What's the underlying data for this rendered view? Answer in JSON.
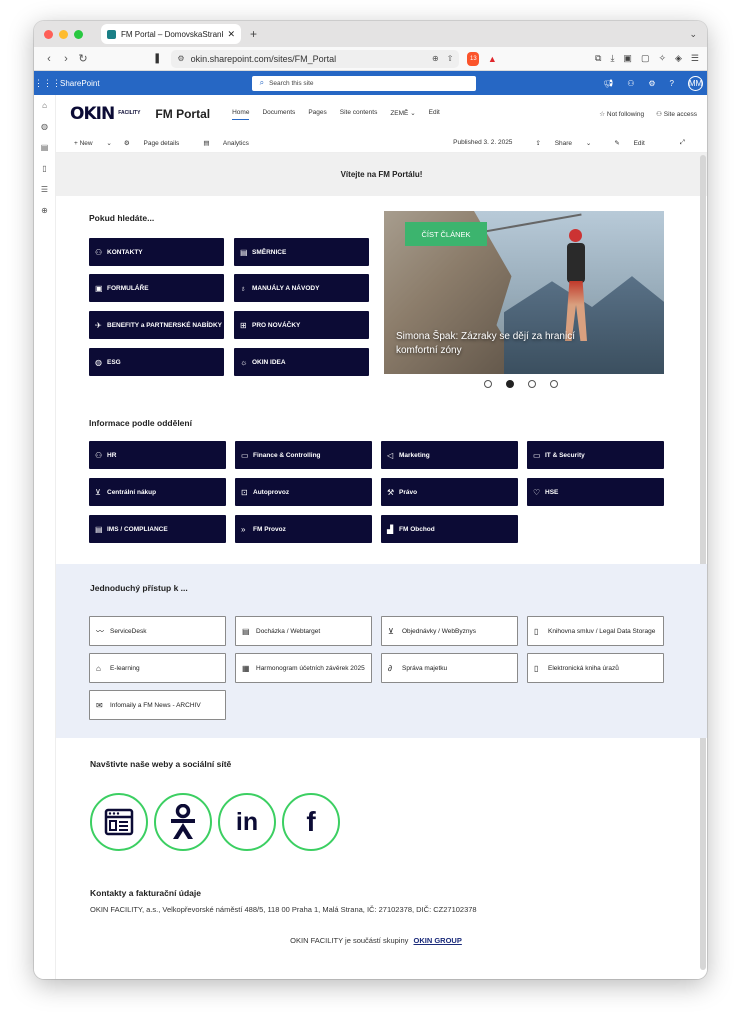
{
  "browser": {
    "tab_title": "FM Portal – DomovskaStranka",
    "url": "okin.sharepoint.com/sites/FM_Portal",
    "badge_count": "13"
  },
  "suitebar": {
    "app_name": "SharePoint",
    "search_placeholder": "Search this site",
    "user_initials": "MM"
  },
  "site": {
    "logo_text": "OKIN",
    "logo_sub": "FACILITY",
    "title": "FM Portal",
    "nav": [
      "Home",
      "Documents",
      "Pages",
      "Site contents",
      "ZEMĚ",
      "Edit"
    ],
    "follow": "Not following",
    "access": "Site access"
  },
  "commandbar": {
    "new": "New",
    "page_details": "Page details",
    "analytics": "Analytics",
    "published": "Published 3. 2. 2025",
    "share": "Share",
    "edit": "Edit"
  },
  "welcome": "Vítejte na FM Portálu!",
  "pokud": {
    "heading": "Pokud hledáte...",
    "buttons": [
      {
        "label": "KONTAKTY",
        "icon": "person-icon"
      },
      {
        "label": "SMĚRNICE",
        "icon": "document-icon"
      },
      {
        "label": "FORMULÁŘE",
        "icon": "form-icon"
      },
      {
        "label": "MANUÁLY A NÁVODY",
        "icon": "lightbulb-icon"
      },
      {
        "label": "BENEFITY a PARTNERSKÉ NABÍDKY",
        "icon": "airplane-icon"
      },
      {
        "label": "PRO NOVÁČKY",
        "icon": "org-chart-icon"
      },
      {
        "label": "ESG",
        "icon": "globe-icon"
      },
      {
        "label": "OKIN IDEA",
        "icon": "idea-icon"
      }
    ]
  },
  "carousel": {
    "button": "ČÍST ČLÁNEK",
    "caption": "Simona Špak: Zázraky se dějí za hranicí komfortní zóny",
    "active_index": 2,
    "count": 4
  },
  "informace": {
    "heading": "Informace podle oddělení",
    "buttons": [
      {
        "label": "HR",
        "icon": "people-icon"
      },
      {
        "label": "Finance & Controlling",
        "icon": "money-icon"
      },
      {
        "label": "Marketing",
        "icon": "megaphone-icon"
      },
      {
        "label": "IT & Security",
        "icon": "computer-icon"
      },
      {
        "label": "Centrální nákup",
        "icon": "cart-icon"
      },
      {
        "label": "Autoprovoz",
        "icon": "car-icon"
      },
      {
        "label": "Právo",
        "icon": "gavel-icon"
      },
      {
        "label": "HSE",
        "icon": "heart-icon"
      },
      {
        "label": "IMS / COMPLIANCE",
        "icon": "clipboard-icon"
      },
      {
        "label": "FM Provoz",
        "icon": "forward-icon"
      },
      {
        "label": "FM Obchod",
        "icon": "bar-chart-icon"
      }
    ]
  },
  "jednoduchy": {
    "heading": "Jednoduchý přístup k ...",
    "buttons": [
      {
        "label": "ServiceDesk",
        "icon": "wave-icon"
      },
      {
        "label": "Docházka / Webtarget",
        "icon": "calendar-icon"
      },
      {
        "label": "Objednávky / WebByznys",
        "icon": "cart-icon"
      },
      {
        "label": "Knihovna smluv / Legal Data Storage",
        "icon": "document-lock-icon"
      },
      {
        "label": "E-learning",
        "icon": "graduation-cap-icon"
      },
      {
        "label": "Harmonogram účetních závěrek 2025",
        "icon": "calculator-icon"
      },
      {
        "label": "Správa majetku",
        "icon": "paperclip-icon"
      },
      {
        "label": "Elektronická kniha úrazů",
        "icon": "document-edit-icon"
      },
      {
        "label": "Infomaily a FM News - ARCHIV",
        "icon": "mail-icon"
      }
    ]
  },
  "social": {
    "heading": "Navštivte naše weby a sociální sítě",
    "links": [
      {
        "name": "web",
        "icon": "website-icon"
      },
      {
        "name": "okin-group",
        "icon": "okin-person-icon"
      },
      {
        "name": "linkedin",
        "icon": "linkedin-icon",
        "glyph": "in"
      },
      {
        "name": "facebook",
        "icon": "facebook-icon",
        "glyph": "f"
      }
    ]
  },
  "contacts": {
    "heading": "Kontakty a fakturační údaje",
    "text": "OKIN FACILITY, a.s., Velkopřevorské náměstí 488/5, 118 00 Praha 1, Malá Strana, IČ: 27102378, DIČ: CZ27102378",
    "group_prefix": "OKIN FACILITY je součástí skupiny",
    "group_link": "OKIN GROUP"
  },
  "colors": {
    "dark_button": "#0c0b35",
    "suite_blue": "#2667c4",
    "green": "#3ccf62",
    "light_band": "#ebeff8"
  }
}
